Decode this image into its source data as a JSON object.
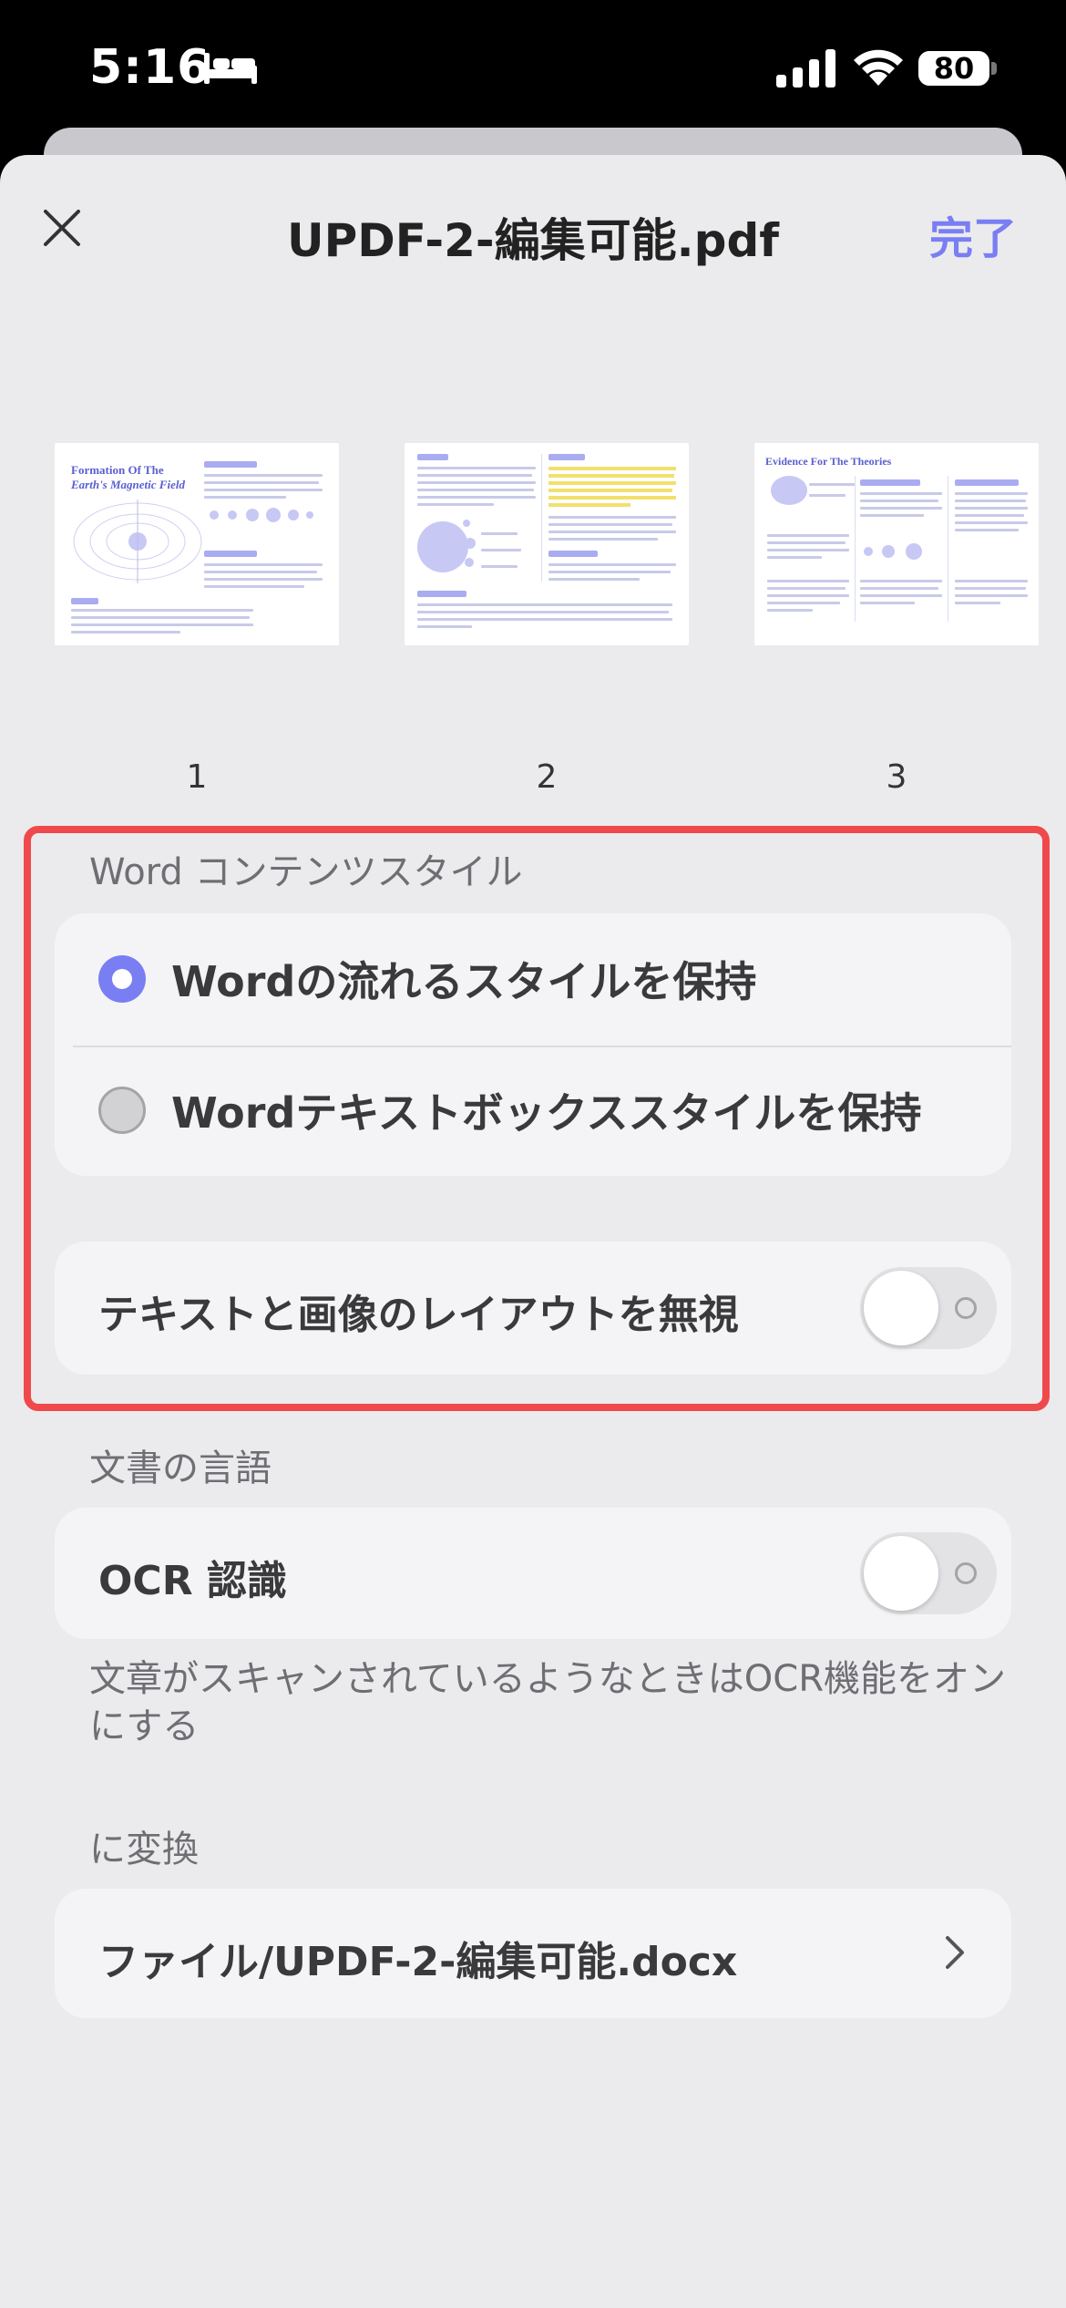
{
  "status_bar": {
    "time": "5:16",
    "battery": "80"
  },
  "header": {
    "title": "UPDF-2-編集可能.pdf",
    "done_label": "完了"
  },
  "thumbnails": {
    "pages": [
      "1",
      "2",
      "3"
    ],
    "page1": {
      "title_line1": "Formation Of The",
      "title_line2": "Earth's Magnetic Field"
    },
    "page3": {
      "title": "Evidence For The Theories"
    }
  },
  "word_style": {
    "section_label": "Word コンテンツスタイル",
    "options": [
      {
        "label": "Wordの流れるスタイルを保持",
        "selected": true
      },
      {
        "label": "Wordテキストボックススタイルを保持",
        "selected": false
      }
    ],
    "ignore_layout_label": "テキストと画像のレイアウトを無視",
    "ignore_layout_on": false
  },
  "language": {
    "section_label": "文書の言語",
    "ocr_label": "OCR 認識",
    "ocr_on": false,
    "help_text": "文章がスキャンされているようなときはOCR機能をオンにする"
  },
  "convert": {
    "section_label": "に変換",
    "path": "ファイル/UPDF-2-編集可能.docx"
  },
  "colors": {
    "accent": "#7a7ef3",
    "highlight_frame": "#f0494b"
  }
}
